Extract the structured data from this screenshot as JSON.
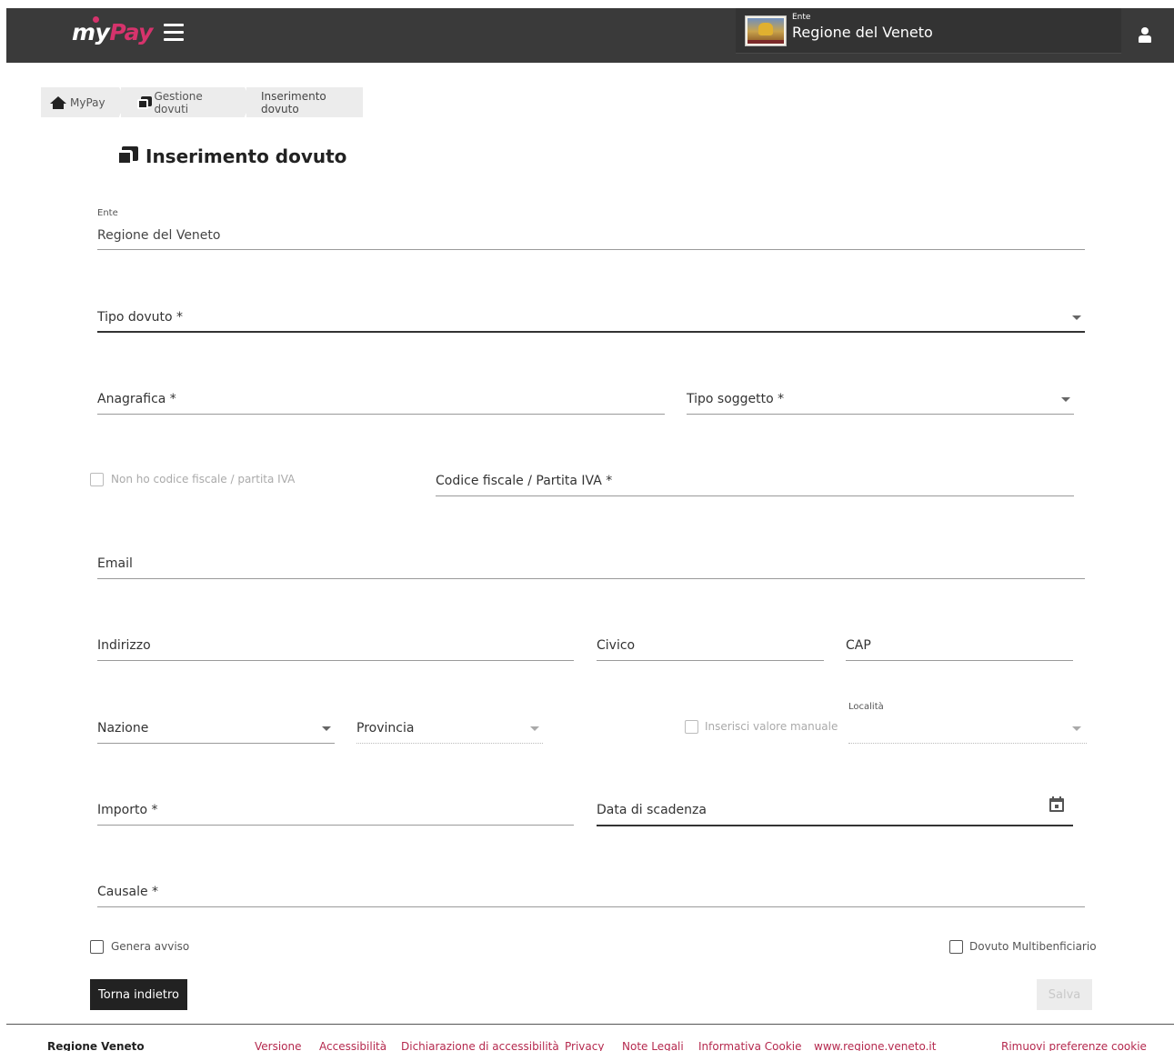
{
  "header": {
    "logo_prefix": "my",
    "logo_suffix": "Pay",
    "ente_caption": "Ente",
    "ente_name": "Regione del Veneto"
  },
  "breadcrumb": {
    "home": "MyPay",
    "section": "Gestione dovuti",
    "current": "Inserimento dovuto"
  },
  "page": {
    "title": "Inserimento dovuto"
  },
  "form": {
    "ente_label": "Ente",
    "ente_value": "Regione del Veneto",
    "tipo_dovuto": "Tipo dovuto *",
    "anagrafica": "Anagrafica *",
    "tipo_soggetto": "Tipo soggetto *",
    "no_codice_fiscale": "Non ho codice fiscale / partita IVA",
    "codice_fiscale": "Codice fiscale / Partita IVA *",
    "email": "Email",
    "indirizzo": "Indirizzo",
    "civico": "Civico",
    "cap": "CAP",
    "nazione": "Nazione",
    "provincia": "Provincia",
    "inserisci_manuale": "Inserisci valore manuale",
    "localita": "Località",
    "importo": "Importo *",
    "data_scadenza": "Data di scadenza",
    "causale": "Causale *",
    "genera_avviso": "Genera avviso",
    "multibeneficiario": "Dovuto Multibenficiario"
  },
  "buttons": {
    "back": "Torna indietro",
    "save": "Salva"
  },
  "footer": {
    "brand": "Regione Veneto",
    "links": [
      "Versione",
      "Accessibilità",
      "Dichiarazione di accessibilità",
      "Privacy",
      "Note Legali",
      "Informativa Cookie",
      "www.regione.veneto.it",
      "Rimuovi preferenze cookie"
    ]
  },
  "colors": {
    "header_bg": "#3a3a3a",
    "accent": "#d6336c",
    "footer_link": "#b5294e"
  }
}
